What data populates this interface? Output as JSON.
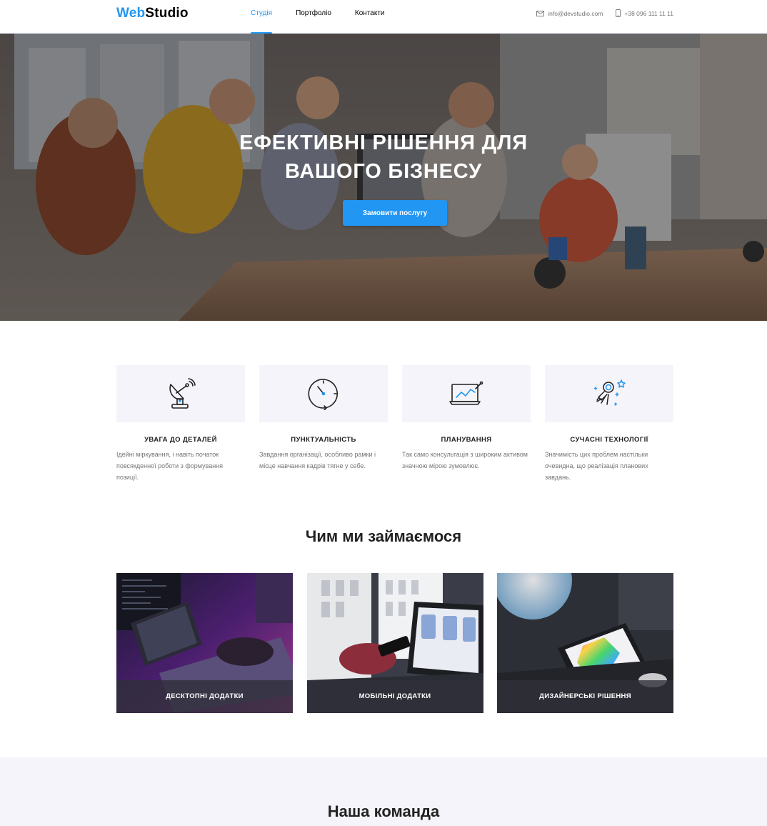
{
  "header": {
    "logo_part1": "Web",
    "logo_part2": "Studio",
    "nav": [
      {
        "label": "Студія",
        "active": true
      },
      {
        "label": "Портфоліо",
        "active": false
      },
      {
        "label": "Контакти",
        "active": false
      }
    ],
    "email": "info@devstudio.com",
    "phone": "+38 096 111 11 11"
  },
  "hero": {
    "title_line1": "Ефективні рішення для",
    "title_line2": "вашого бізнесу",
    "button_label": "Замовити послугу"
  },
  "features": [
    {
      "icon": "antenna-icon",
      "title": "Увага до деталей",
      "text": "Ідейні міркування, і навіть початок повсякденної роботи з формування позиції."
    },
    {
      "icon": "clock-icon",
      "title": "Пунктуальність",
      "text": "Завдання організації, особливо рамки і місце навчання кадрів тягне у себе."
    },
    {
      "icon": "chart-monitor-icon",
      "title": "Планування",
      "text": "Так само консультація з широким активом значною мірою зумовлює."
    },
    {
      "icon": "astronaut-icon",
      "title": "Сучасні технології",
      "text": "Значимість цих проблем настільки очевидна, що реалізація планових завдань."
    }
  ],
  "services": {
    "title": "Чим ми займаємося",
    "items": [
      {
        "caption": "Десктопні додатки"
      },
      {
        "caption": "Мобільні додатки"
      },
      {
        "caption": "Дизайнерські рішення"
      }
    ]
  },
  "team": {
    "title": "Наша команда"
  },
  "colors": {
    "accent": "#2196f3",
    "text": "#212121",
    "muted": "#757575",
    "light_bg": "#f5f4fa"
  }
}
